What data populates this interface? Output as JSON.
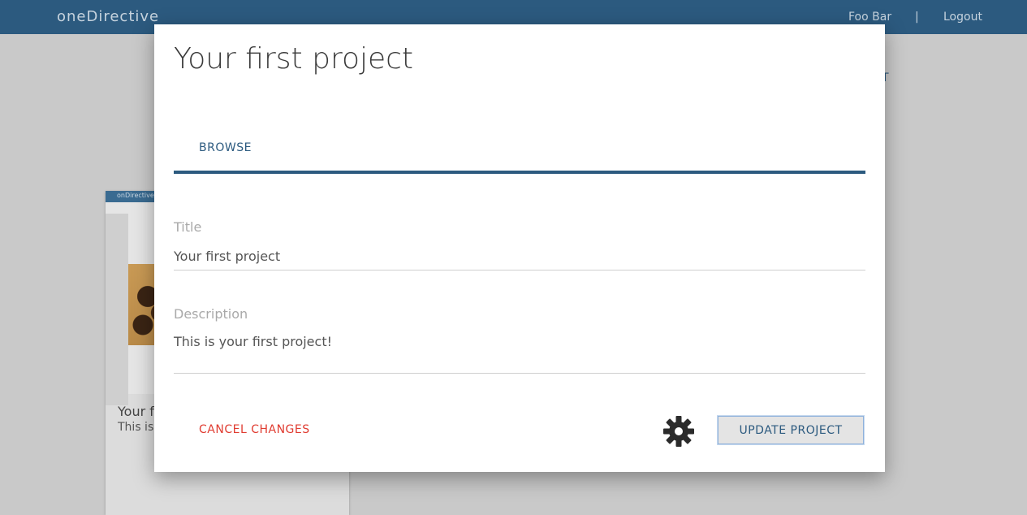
{
  "topbar": {
    "brand": "oneDirective",
    "user": "Foo Bar",
    "separator": "|",
    "logout": "Logout"
  },
  "background": {
    "stray_text": "T",
    "card": {
      "header_text": "onDirective",
      "title": "Your first project",
      "description": "This is your first project!"
    }
  },
  "modal": {
    "title": "Your first project",
    "tabs": [
      {
        "label": "BROWSE"
      }
    ],
    "fields": {
      "title": {
        "label": "Title",
        "value": "Your first project"
      },
      "description": {
        "label": "Description",
        "value": "This is your first project!"
      }
    },
    "actions": {
      "cancel": "CANCEL CHANGES",
      "update": "UPDATE PROJECT",
      "settings_icon": "gear-icon"
    }
  },
  "colors": {
    "brand": "#2c5a7f",
    "danger": "#e03c31"
  }
}
